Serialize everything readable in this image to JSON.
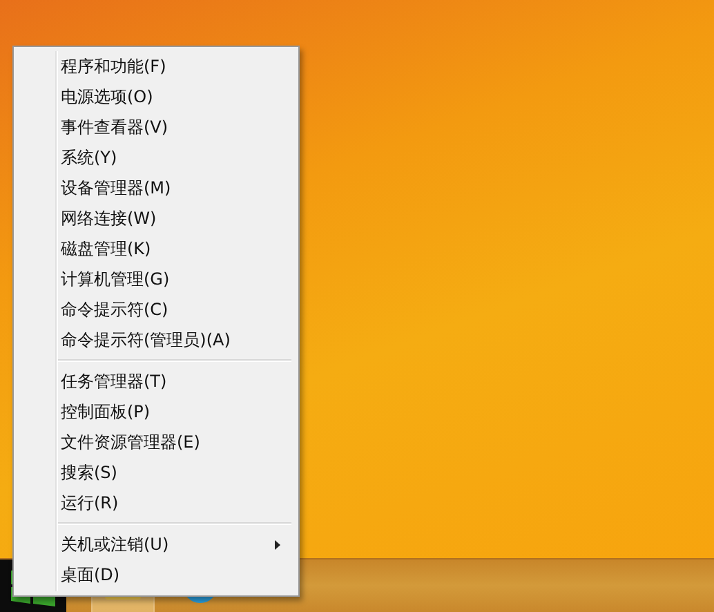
{
  "context_menu": {
    "groups": [
      {
        "items": [
          {
            "label": "程序和功能(F)",
            "submenu": false
          },
          {
            "label": "电源选项(O)",
            "submenu": false
          },
          {
            "label": "事件查看器(V)",
            "submenu": false
          },
          {
            "label": "系统(Y)",
            "submenu": false
          },
          {
            "label": "设备管理器(M)",
            "submenu": false
          },
          {
            "label": "网络连接(W)",
            "submenu": false
          },
          {
            "label": "磁盘管理(K)",
            "submenu": false
          },
          {
            "label": "计算机管理(G)",
            "submenu": false
          },
          {
            "label": "命令提示符(C)",
            "submenu": false
          },
          {
            "label": "命令提示符(管理员)(A)",
            "submenu": false
          }
        ]
      },
      {
        "items": [
          {
            "label": "任务管理器(T)",
            "submenu": false
          },
          {
            "label": "控制面板(P)",
            "submenu": false
          },
          {
            "label": "文件资源管理器(E)",
            "submenu": false
          },
          {
            "label": "搜索(S)",
            "submenu": false
          },
          {
            "label": "运行(R)",
            "submenu": false
          }
        ]
      },
      {
        "items": [
          {
            "label": "关机或注销(U)",
            "submenu": true
          },
          {
            "label": "桌面(D)",
            "submenu": false
          }
        ]
      }
    ]
  }
}
